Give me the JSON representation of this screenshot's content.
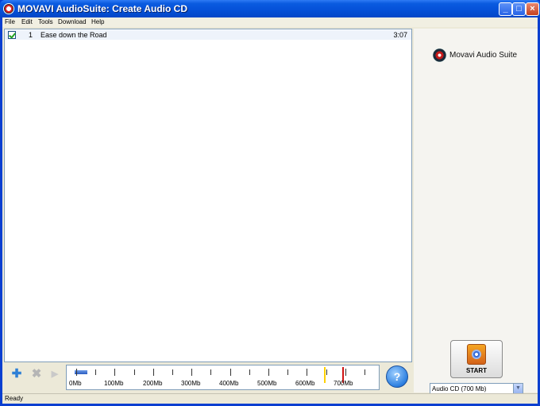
{
  "window": {
    "title": "MOVAVI AudioSuite: Create Audio CD"
  },
  "menu": [
    {
      "label": "File"
    },
    {
      "label": "Edit"
    },
    {
      "label": "Tools"
    },
    {
      "label": "Download"
    },
    {
      "label": "Help"
    }
  ],
  "tracks": [
    {
      "checked": true,
      "number": "1",
      "title": "Ease down the Road",
      "duration": "3:07"
    }
  ],
  "brand": {
    "name": "Movavi Audio Suite"
  },
  "start_button": {
    "label": "START"
  },
  "disc_type": {
    "selected": "Audio CD (700 Mb)"
  },
  "toolbar": {
    "add_icon": "add-icon",
    "remove_icon": "remove-icon",
    "play_icon": "play-icon"
  },
  "size_scale": {
    "labels": [
      "0Mb",
      "100Mb",
      "200Mb",
      "300Mb",
      "400Mb",
      "500Mb",
      "600Mb",
      "700Mb"
    ],
    "used_mb": 32,
    "markers": {
      "yellow_color": "#ffd000",
      "red_color": "#d01414"
    }
  },
  "status": {
    "text": "Ready"
  },
  "colors": {
    "titlebar": "#0550d7",
    "accent": "#2f80d6"
  }
}
